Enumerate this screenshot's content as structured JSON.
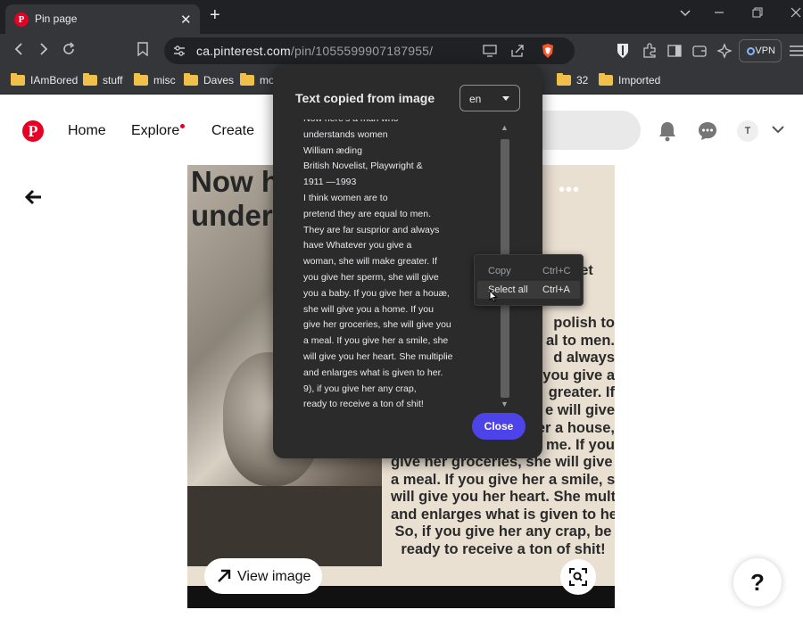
{
  "browser": {
    "tab_title": "Pin page",
    "tab_close": "✕",
    "new_tab": "+",
    "url_domain": "ca.pinterest.com",
    "url_path": "/pin/1055599907187955/",
    "vpn_label": "VPN",
    "bookmarks": [
      "IAmBored",
      "stuff",
      "misc",
      "Daves",
      "mo",
      "32",
      "Imported"
    ]
  },
  "pinterest": {
    "nav": [
      "Home",
      "Explore",
      "Create"
    ],
    "avatar_initial": "T",
    "pin_image_title": "Now h\nunders",
    "pin_image_poet": "Poet",
    "pin_image_quote": "polish to\nal to men.\nd always\nyou give a\ngreater. If\ne will give\ner a house,\nme. If you",
    "pin_image_bottom": "give her groceries, she will give you\na meal. If you give her a smile, she\nwill give you her heart. She multiplies\nand enlarges what is given to her.\nSo, if you give her any crap, be\nready to receive a ton of shit!",
    "view_image_label": "View image",
    "help_label": "?",
    "more_label": "•••"
  },
  "popup": {
    "title": "Text copied from image",
    "language": "en",
    "text_lines": [
      "Now here's a man who",
      "understands women",
      "William æding",
      "British Novelist, Playwright &",
      "1911 —1993",
      "I think women are to",
      "pretend they are equal to men.",
      "They are far susprior and always",
      "have Whatever you give a",
      "woman, she will make greater. If",
      "you give her sperm, she will give",
      "you a baby. If you give her a houæ,",
      "she will give you a home. If you",
      "give her groceries, she will give you",
      "a meal. If you give her a smile, she",
      "will give you her heart. She multiplie",
      "and enlarges what is given to her.",
      "9), if you give her any crap,",
      "ready to receive a ton of shit!"
    ],
    "close_label": "Close"
  },
  "context_menu": {
    "items": [
      {
        "label": "Copy",
        "shortcut": "Ctrl+C",
        "enabled": false
      },
      {
        "label": "Select all",
        "shortcut": "Ctrl+A",
        "enabled": true
      }
    ]
  },
  "colors": {
    "pinterest_red": "#e60023",
    "close_button": "#4c44e8",
    "dialog_bg": "#2b2b2b"
  }
}
